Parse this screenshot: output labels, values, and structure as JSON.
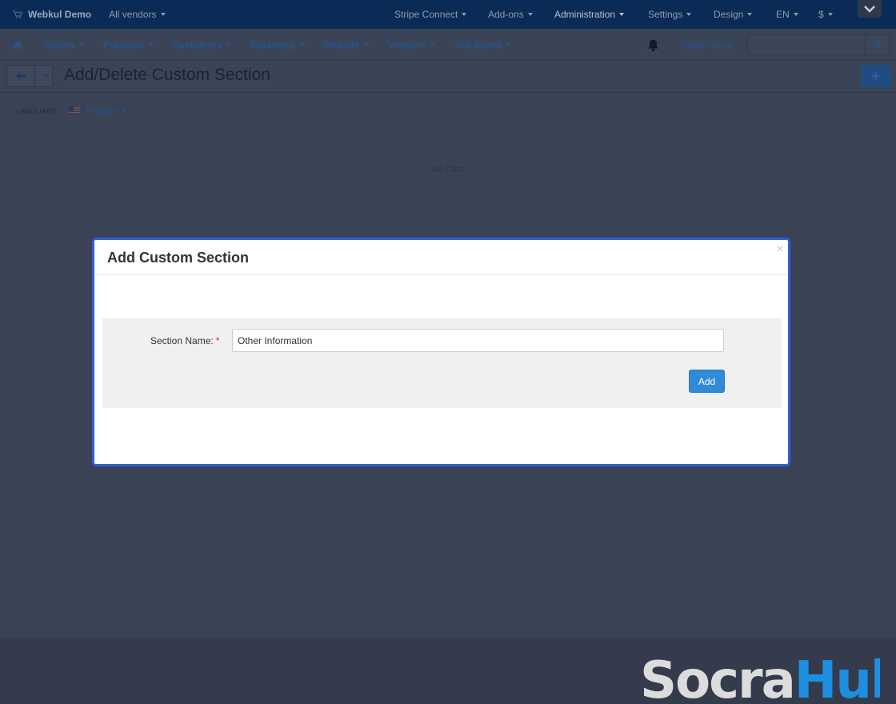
{
  "topbar": {
    "brand": "Webkul Demo",
    "vendors": "All vendors",
    "stripe": "Stripe Connect",
    "addons": "Add-ons",
    "administration": "Administration",
    "settings": "Settings",
    "design": "Design",
    "language": "EN",
    "currency": "$"
  },
  "menubar": {
    "items": [
      "Orders",
      "Products",
      "Customers",
      "Marketing",
      "Website",
      "Vendors",
      "Job Board"
    ],
    "quick_menu": "Quick menu",
    "search_value": ""
  },
  "titlebar": {
    "title": "Add/Delete Custom Section",
    "plus": "+"
  },
  "language_bar": {
    "label": "LANGUAGE:",
    "value": "English"
  },
  "content": {
    "empty_text": "No Data"
  },
  "modal": {
    "title": "Add Custom Section",
    "close": "×",
    "field_label": "Section Name:",
    "required_mark": "*",
    "field_value": "Other Information",
    "submit_label": "Add"
  },
  "watermark": {
    "part1": "Socra",
    "part2": "Hub"
  },
  "colors": {
    "modal_border": "#2f5fd6",
    "primary_button": "#2f8ad8",
    "watermark_gray": "#dcdcdc",
    "watermark_blue": "#1e8fe0"
  }
}
